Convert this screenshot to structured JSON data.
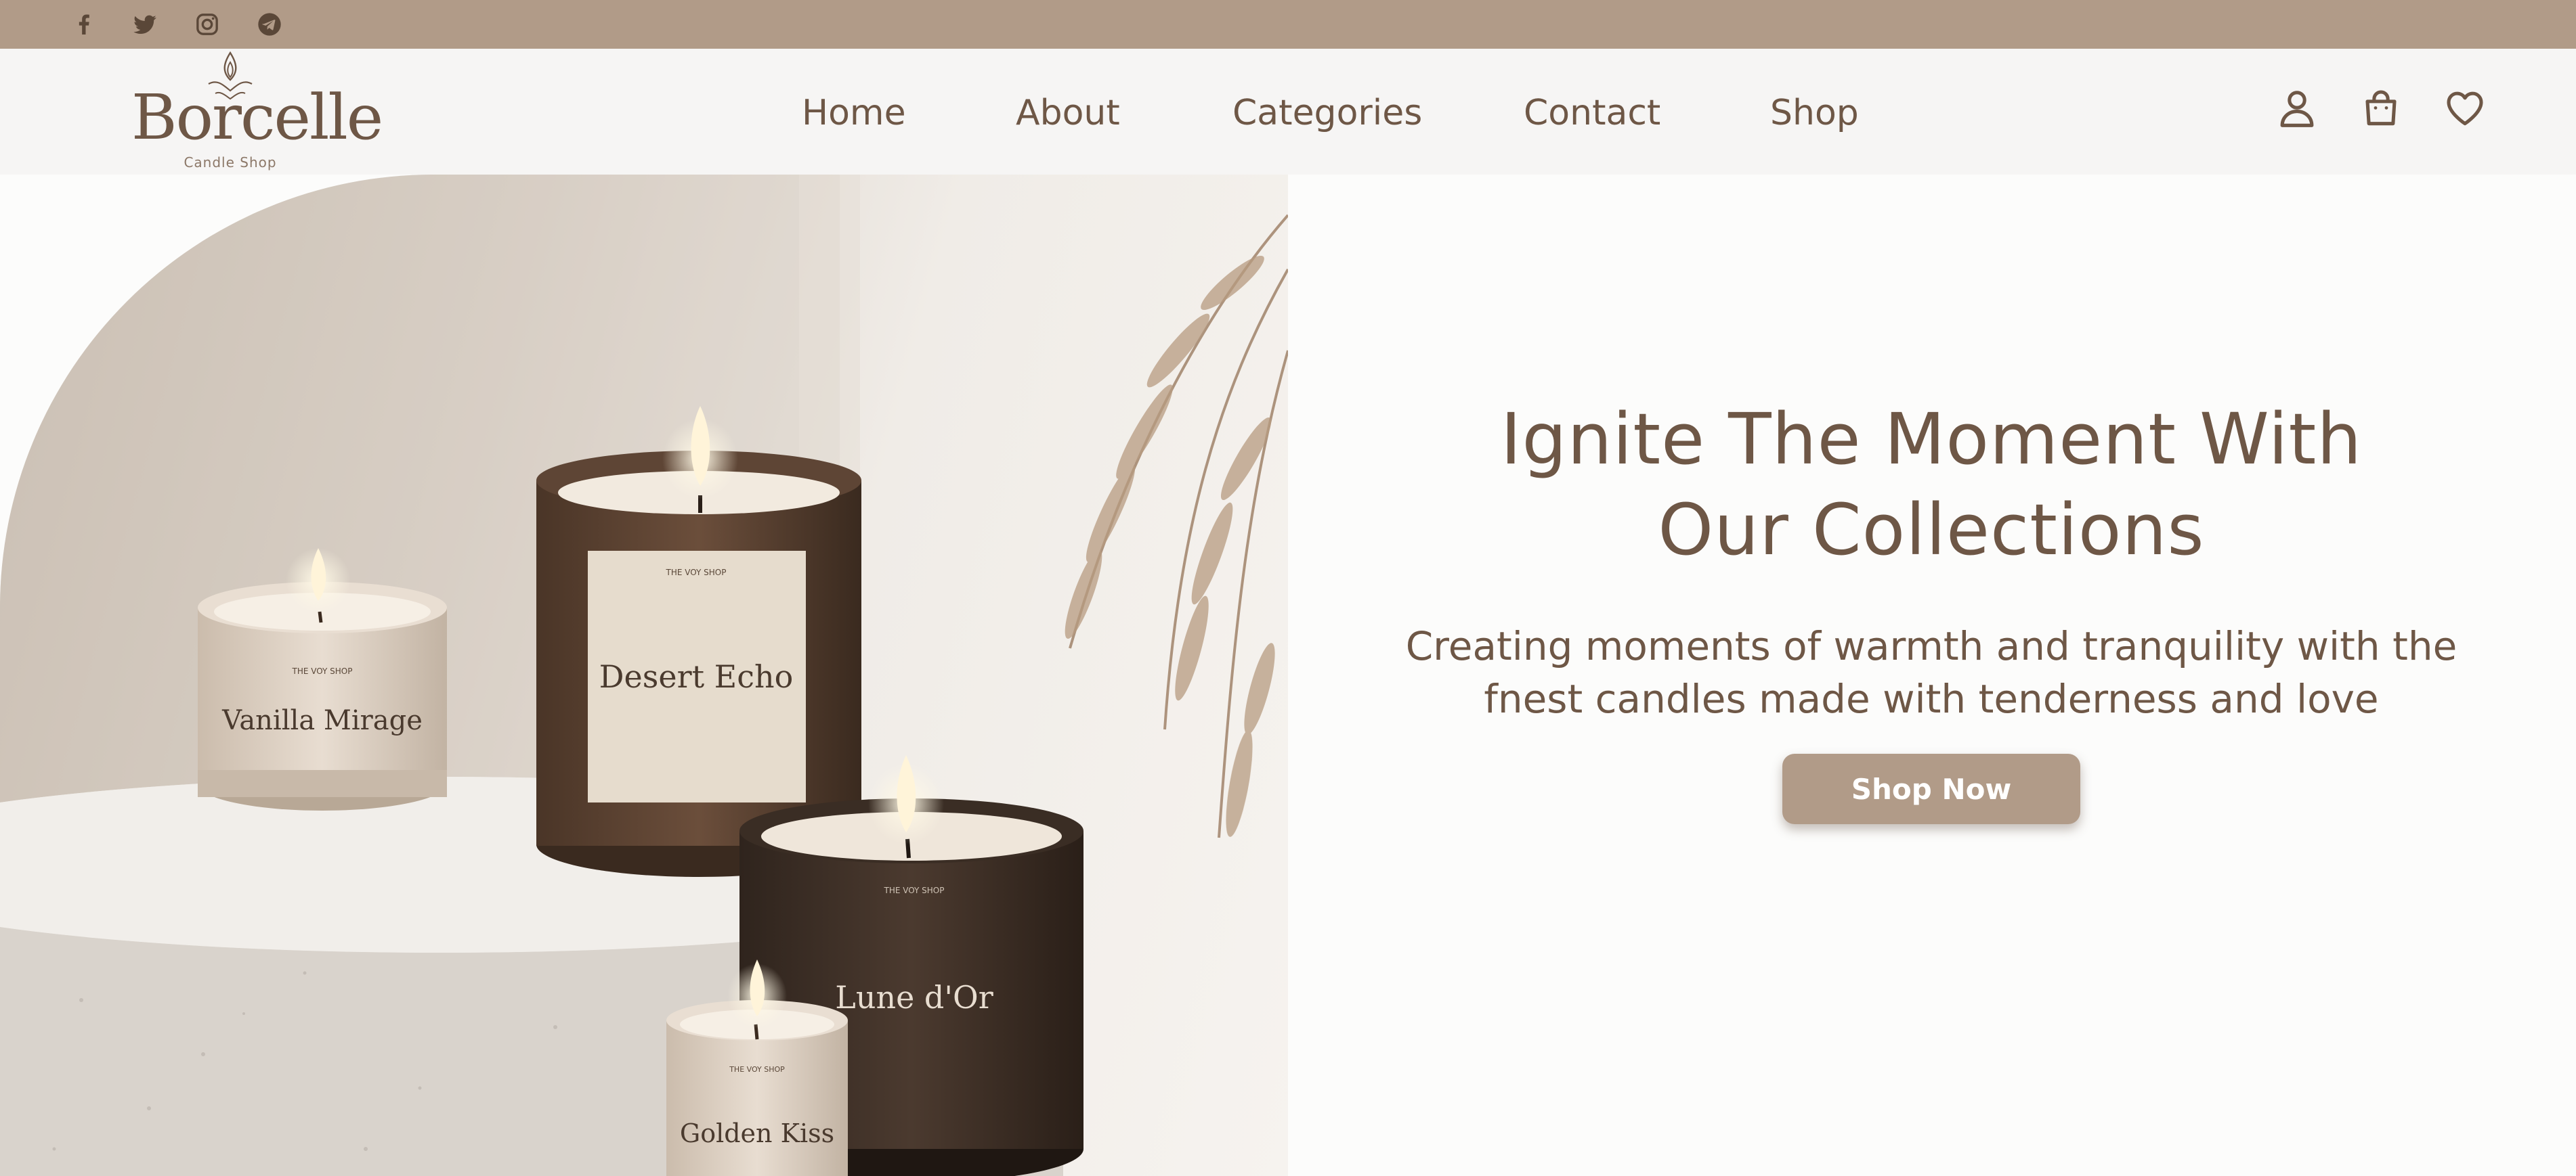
{
  "social": {
    "icons": [
      "facebook-icon",
      "twitter-icon",
      "instagram-icon",
      "telegram-icon"
    ]
  },
  "brand": {
    "name": "Borcelle",
    "tagline": "Candle Shop"
  },
  "nav": {
    "items": [
      {
        "label": "Home"
      },
      {
        "label": "About"
      },
      {
        "label": "Categories"
      },
      {
        "label": "Contact"
      },
      {
        "label": "Shop"
      }
    ]
  },
  "header_icons": [
    "user-icon",
    "shopping-bag-icon",
    "heart-icon"
  ],
  "hero": {
    "image_alt": "Candles: Vanilla Mirage, Desert Echo, Lune d'Or, Golden Kiss",
    "candle_labels": {
      "brand": "THE VOY SHOP",
      "vanilla": "Vanilla Mirage",
      "desert": "Desert Echo",
      "lune": "Lune d'Or",
      "golden": "Golden Kiss"
    },
    "headline_line1": "Ignite The Moment With",
    "headline_line2": "Our Collections",
    "subhead_line1": "Creating moments of warmth and tranquility with the",
    "subhead_line2": "fnest candles made with tenderness and love",
    "cta_label": "Shop Now"
  },
  "colors": {
    "accent": "#b19b88",
    "text": "#6e5746",
    "background": "#fcfcfb"
  }
}
